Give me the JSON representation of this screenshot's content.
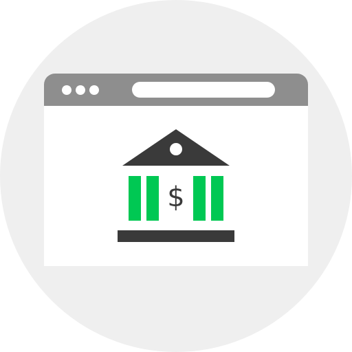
{
  "colors": {
    "background_circle": "#efefef",
    "window_chrome": "#8e8e8e",
    "window_body": "#ffffff",
    "bank_dark": "#3a3a3a",
    "bank_columns": "#00c853"
  },
  "icons": {
    "window": "browser-window-icon",
    "bank": "bank-building-icon",
    "currency": "dollar-sign-icon"
  },
  "bank": {
    "currency_symbol": "$"
  }
}
